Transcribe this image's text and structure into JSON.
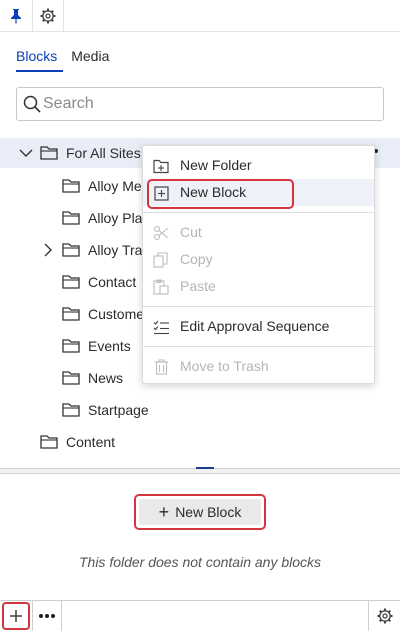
{
  "tabs": [
    {
      "label": "Blocks"
    },
    {
      "label": "Media"
    }
  ],
  "search": {
    "placeholder": "Search"
  },
  "tree": {
    "root": {
      "label": "For All Sites"
    },
    "children": [
      {
        "label": "Alloy Me"
      },
      {
        "label": "Alloy Pla"
      },
      {
        "label": "Alloy Tra"
      },
      {
        "label": "Contact"
      },
      {
        "label": "Custome"
      },
      {
        "label": "Events"
      },
      {
        "label": "News"
      },
      {
        "label": "Startpage"
      }
    ],
    "content": {
      "label": "Content"
    }
  },
  "context_menu": {
    "new_folder": "New Folder",
    "new_block": "New Block",
    "cut": "Cut",
    "copy": "Copy",
    "paste": "Paste",
    "edit_approval": "Edit Approval Sequence",
    "move_to_trash": "Move to Trash"
  },
  "main": {
    "new_block_label": "New Block",
    "empty_message": "This folder does not contain any blocks"
  },
  "colors": {
    "accent": "#0a3fb8",
    "highlight_border": "#d4343d",
    "selected_bg": "#e9edf7"
  }
}
